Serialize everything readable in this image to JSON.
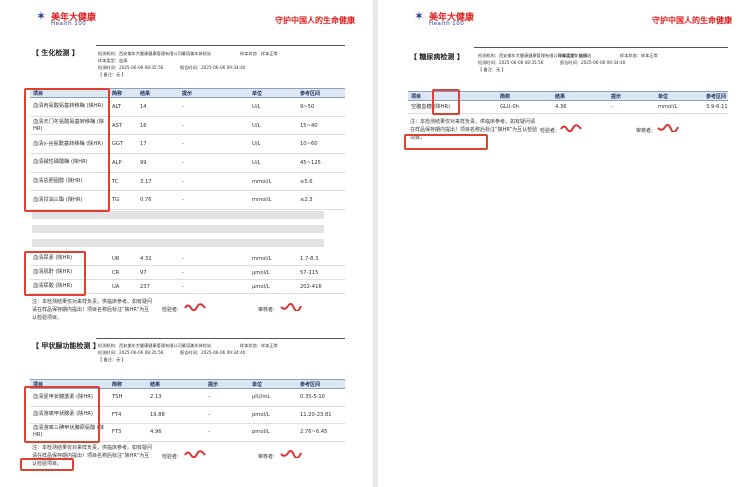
{
  "brand": {
    "name": "美年大健康",
    "sub": "Health 100",
    "slogan": "守护中国人的生命健康"
  },
  "meta_labels": {
    "org": "检测机构：西安美年大健康健康管理有限公司雁塔美年体检站",
    "sample_type": "样本类型：血清",
    "sample_state": "样本状态：样本正常",
    "sample_type_right": "样本类型：血清",
    "detect_time": "检测时间：2025-06-06 08:35:56",
    "report_time": "报告时间：2025-06-06 09:34:40",
    "remark": "【 备注：无 】"
  },
  "columns": {
    "item": "项目",
    "abbr": "简称",
    "result": "结果",
    "hint": "提示",
    "unit": "单位",
    "ref": "参考区间"
  },
  "biochem": {
    "title": "【 生化检测 】",
    "rows_a": [
      {
        "item": "血清丙氨酸氨基转移酶 (陕HR)",
        "abbr": "ALT",
        "result": "14",
        "hint": "-",
        "unit": "U/L",
        "ref": "9~50"
      },
      {
        "item": "血清天门冬氨酸氨基转移酶 (陕HR)",
        "abbr": "AST",
        "result": "16",
        "hint": "-",
        "unit": "U/L",
        "ref": "15~40"
      },
      {
        "item": "血清γ-谷氨酰基转移酶 (陕HR)",
        "abbr": "GGT",
        "result": "17",
        "hint": "-",
        "unit": "U/L",
        "ref": "10~60"
      },
      {
        "item": "血清碱性磷酸酶 (陕HR)",
        "abbr": "ALP",
        "result": "99",
        "hint": "-",
        "unit": "U/L",
        "ref": "45~125"
      },
      {
        "item": "血清总胆固醇 (陕HR)",
        "abbr": "TC",
        "result": "3.17",
        "hint": "-",
        "unit": "mmol/L",
        "ref": "≤5.6"
      },
      {
        "item": "血清甘油三酯 (陕HR)",
        "abbr": "TG",
        "result": "0.76",
        "hint": "-",
        "unit": "mmol/L",
        "ref": "≤2.3"
      }
    ],
    "rows_b": [
      {
        "item": "血清尿素 (陕HR)",
        "abbr": "UR",
        "result": "4.32",
        "hint": "-",
        "unit": "mmol/L",
        "ref": "1.7-8.3"
      },
      {
        "item": "血清肌酐 (陕HR)",
        "abbr": "CR",
        "result": "97",
        "hint": "-",
        "unit": "μmol/L",
        "ref": "57-115"
      },
      {
        "item": "血清尿酸 (陕HR)",
        "abbr": "UA",
        "result": "237",
        "hint": "-",
        "unit": "μmol/L",
        "ref": "202-416"
      }
    ]
  },
  "thyroid": {
    "title": "【 甲状腺功能检测 】",
    "rows": [
      {
        "item": "血清促甲状腺激素 (陕HR)",
        "abbr": "TSH",
        "result": "2.13",
        "hint": "-",
        "unit": "μIU/mL",
        "ref": "0.35-5.10"
      },
      {
        "item": "血清游离甲状腺素 (陕HR)",
        "abbr": "FT4",
        "result": "19.88",
        "hint": "-",
        "unit": "pmol/L",
        "ref": "11.20-23.81"
      },
      {
        "item": "血清游离三碘甲状腺原氨酸 (陕HR)",
        "abbr": "FT3",
        "result": "4.96",
        "hint": "-",
        "unit": "pmol/L",
        "ref": "2.76~6.45"
      }
    ]
  },
  "glucose": {
    "title": "【 糖尿病检测 】",
    "rows": [
      {
        "item": "空腹血糖 (陕HR)",
        "abbr": "GLU-0h",
        "result": "4.36",
        "hint": "-",
        "unit": "mmol/L",
        "ref": "3.9-6.11"
      }
    ]
  },
  "footer": {
    "note": "注：本检测结果仅对来样负责，供临床参考。如有疑问请在样品保存期内提出！项目名称后标注“陕HR”为互认检验项目。",
    "tester": "检验者:",
    "reviewer": "审核者:"
  },
  "colors": {
    "accent_red": "#e04030",
    "brand_blue": "#1f3a93",
    "header_fill": "#dde7f4"
  }
}
